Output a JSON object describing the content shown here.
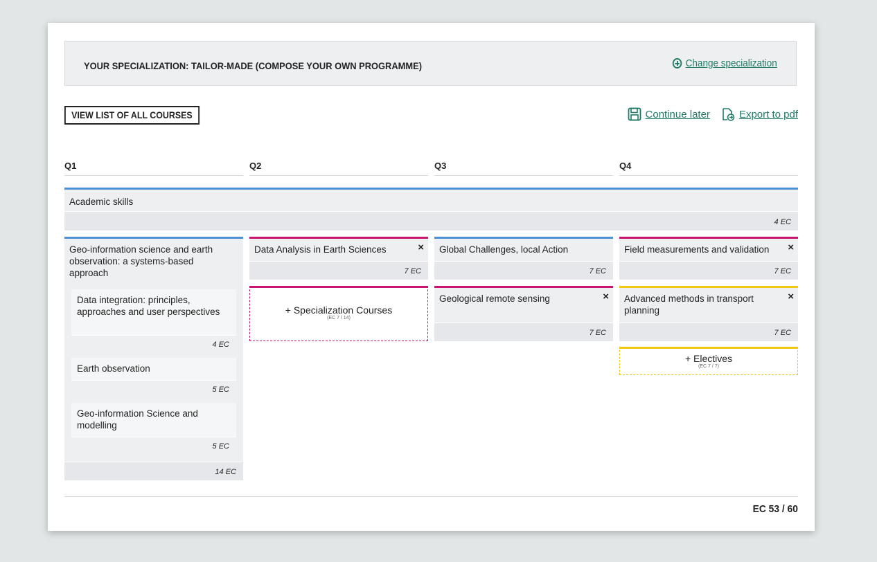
{
  "header": {
    "specialization_title": "YOUR SPECIALIZATION: TAILOR-MADE (COMPOSE YOUR OWN PROGRAMME)",
    "change_label": "Change specialization"
  },
  "toolbar": {
    "view_list_label": "VIEW LIST OF ALL COURSES",
    "continue_label": "Continue later",
    "export_label": "Export to pdf"
  },
  "quarters": [
    "Q1",
    "Q2",
    "Q3",
    "Q4"
  ],
  "academic_skills": {
    "title": "Academic skills",
    "ec": "4 EC"
  },
  "q1": {
    "group": {
      "title": "Geo-information science and earth observation: a systems-based approach",
      "ec": "14 EC",
      "items": [
        {
          "title": "Data integration: principles, approaches and user perspectives",
          "ec": "4  EC"
        },
        {
          "title": "Earth observation",
          "ec": "5  EC"
        },
        {
          "title": "Geo-information Science and modelling",
          "ec": "5  EC"
        }
      ]
    }
  },
  "q2": {
    "course": {
      "title": "Data Analysis in Earth Sciences",
      "ec": "7 EC"
    },
    "add": {
      "label": "+ Specialization Courses",
      "sub": "(EC 7 / 14)"
    }
  },
  "q3": {
    "courses": [
      {
        "title": "Global Challenges, local Action",
        "ec": "7 EC"
      },
      {
        "title": "Geological remote sensing",
        "ec": "7 EC"
      }
    ]
  },
  "q4": {
    "courses": [
      {
        "title": "Field measurements and validation",
        "ec": "7 EC"
      },
      {
        "title": "Advanced methods in transport planning",
        "ec": "7 EC"
      }
    ],
    "add": {
      "label": "+ Electives",
      "sub": "(EC 7 / 7)"
    }
  },
  "close_glyph": "×",
  "total": "EC 53 / 60",
  "colors": {
    "accent": "#1f7a66",
    "blue": "#4a90d6",
    "pink": "#c8146e",
    "yellow": "#f2c80f"
  },
  "icons": [
    "plus-circle-icon",
    "save-icon",
    "export-pdf-icon",
    "close-icon"
  ]
}
